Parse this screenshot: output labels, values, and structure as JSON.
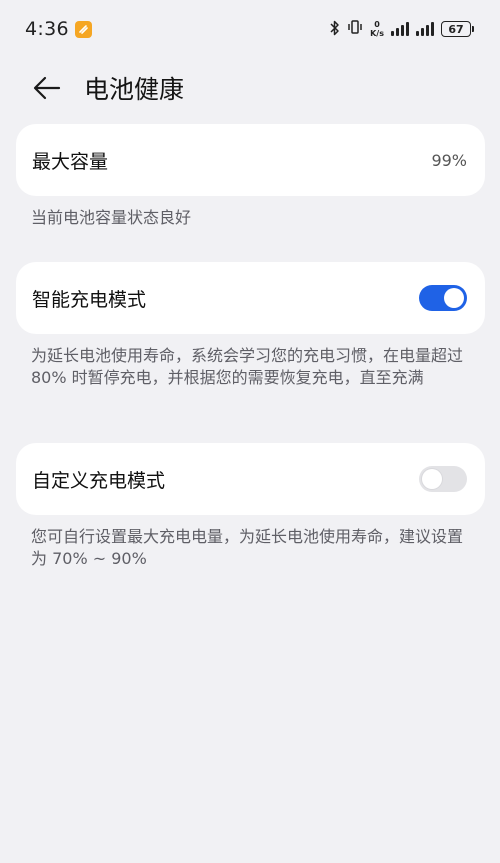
{
  "status_bar": {
    "time": "4:36",
    "net_speed_value": "0",
    "net_speed_unit": "K/s",
    "battery_level": "67",
    "icons": [
      "app-notification-icon",
      "bluetooth-icon",
      "vibrate-icon",
      "signal-icon",
      "battery-icon"
    ]
  },
  "header": {
    "title": "电池健康"
  },
  "max_capacity": {
    "label": "最大容量",
    "value": "99%",
    "description": "当前电池容量状态良好"
  },
  "smart_charging": {
    "label": "智能充电模式",
    "enabled": true,
    "description": "为延长电池使用寿命，系统会学习您的充电习惯，在电量超过 80% 时暂停充电，并根据您的需要恢复充电，直至充满"
  },
  "custom_charging": {
    "label": "自定义充电模式",
    "enabled": false,
    "description": "您可自行设置最大充电电量，为延长电池使用寿命，建议设置为 70% ~ 90%"
  },
  "colors": {
    "background": "#f1f1f4",
    "card": "#ffffff",
    "toggle_on": "#1f62e6",
    "toggle_off": "#e3e3e6"
  }
}
